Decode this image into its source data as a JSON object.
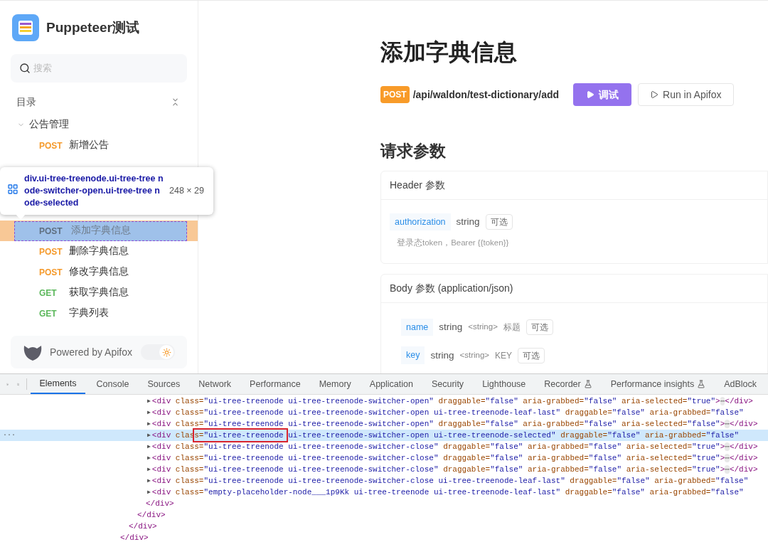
{
  "sidebar": {
    "project_title": "Puppeteer测试",
    "search": {
      "placeholder": "搜索"
    },
    "section_label": "目录",
    "tree": [
      {
        "label": "公告管理",
        "expanded": true,
        "children": [
          {
            "method": "POST",
            "color": "#f59a2b",
            "label": "新增公告",
            "selected": false
          },
          {
            "method": "POST",
            "label": "添加字典信息",
            "selected": true,
            "inspector_tooltip": {
              "selector": "div.ui-tree-treenode.ui-tree-tree node-switcher-open.ui-tree-tree node-selected",
              "size": "248 × 29"
            }
          },
          {
            "method": "POST",
            "color": "#f59a2b",
            "label": "删除字典信息",
            "selected": false
          },
          {
            "method": "POST",
            "color": "#f59a2b",
            "label": "修改字典信息",
            "selected": false
          },
          {
            "method": "GET",
            "color": "#5cb85c",
            "label": "获取字典信息",
            "selected": false
          },
          {
            "method": "GET",
            "color": "#5cb85c",
            "label": "字典列表",
            "selected": false
          }
        ]
      }
    ],
    "footer": {
      "text": "Powered by Apifox",
      "theme_toggle_on": true
    }
  },
  "main": {
    "title": "添加字典信息",
    "method": "POST",
    "path": "/api/waldon/test-dictionary/add",
    "debug_button": "调试",
    "run_button": "Run in Apifox",
    "params_title": "请求参数",
    "header_section": {
      "title": "Header 参数",
      "params": [
        {
          "name": "authorization",
          "type": "string",
          "optional": "可选",
          "description": "登录态token，Bearer {{token}}"
        }
      ]
    },
    "body_section": {
      "title": "Body 参数 (application/json)",
      "params": [
        {
          "name": "name",
          "type": "string",
          "subtype": "<string>",
          "description": "标题",
          "optional": "可选"
        },
        {
          "name": "key",
          "type": "string",
          "subtype": "<string>",
          "description": "KEY",
          "optional": "可选"
        }
      ]
    }
  },
  "devtools": {
    "tabs": [
      {
        "label": "Elements",
        "selected": true,
        "experimental": false
      },
      {
        "label": "Console",
        "selected": false,
        "experimental": false
      },
      {
        "label": "Sources",
        "selected": false,
        "experimental": false
      },
      {
        "label": "Network",
        "selected": false,
        "experimental": false
      },
      {
        "label": "Performance",
        "selected": false,
        "experimental": false
      },
      {
        "label": "Memory",
        "selected": false,
        "experimental": false
      },
      {
        "label": "Application",
        "selected": false,
        "experimental": false
      },
      {
        "label": "Security",
        "selected": false,
        "experimental": false
      },
      {
        "label": "Lighthouse",
        "selected": false,
        "experimental": false
      },
      {
        "label": "Recorder",
        "selected": false,
        "experimental": true
      },
      {
        "label": "Performance insights",
        "selected": false,
        "experimental": true
      },
      {
        "label": "AdBlock",
        "selected": false,
        "experimental": false
      }
    ],
    "nodes": [
      {
        "toggle": "▶",
        "code": "<div class=\"ui-tree-treenode ui-tree-treenode-switcher-open\" draggable=\"false\" aria-grabbed=\"false\" aria-selected=\"true\">⋯</div>",
        "selected": false,
        "boxed": false
      },
      {
        "toggle": "▶",
        "code": "<div class=\"ui-tree-treenode ui-tree-treenode-switcher-open ui-tree-treenode-leaf-last\" draggable=\"false\" aria-grabbed=\"false\"",
        "selected": false,
        "boxed": false
      },
      {
        "toggle": "▶",
        "code": "<div class=\"ui-tree-treenode ui-tree-treenode-switcher-open\" draggable=\"false\" aria-grabbed=\"false\" aria-selected=\"false\">⋯</div>",
        "selected": false,
        "boxed": false
      },
      {
        "toggle": "▶",
        "gutter": "···",
        "code": "<div class=\"ui-tree-treenode ui-tree-treenode-switcher-open ui-tree-treenode-selected\" draggable=\"false\" aria-grabbed=\"false\"",
        "selected": true,
        "boxed": true
      },
      {
        "toggle": "▶",
        "code": "<div class=\"ui-tree-treenode ui-tree-treenode-switcher-close\" draggable=\"false\" aria-grabbed=\"false\" aria-selected=\"true\">⋯</div>",
        "selected": false,
        "boxed": false
      },
      {
        "toggle": "▶",
        "code": "<div class=\"ui-tree-treenode ui-tree-treenode-switcher-close\" draggable=\"false\" aria-grabbed=\"false\" aria-selected=\"true\">⋯</div>",
        "selected": false,
        "boxed": false
      },
      {
        "toggle": "▶",
        "code": "<div class=\"ui-tree-treenode ui-tree-treenode-switcher-close\" draggable=\"false\" aria-grabbed=\"false\" aria-selected=\"true\">⋯</div>",
        "selected": false,
        "boxed": false
      },
      {
        "toggle": "▶",
        "code": "<div class=\"ui-tree-treenode ui-tree-treenode-switcher-close ui-tree-treenode-leaf-last\" draggable=\"false\" aria-grabbed=\"false\"",
        "selected": false,
        "boxed": false
      },
      {
        "toggle": "▶",
        "code": "<div class=\"empty-placeholder-node___1p9Kk ui-tree-treenode ui-tree-treenode-leaf-last\" draggable=\"false\" aria-grabbed=\"false\"",
        "selected": false,
        "boxed": false
      }
    ],
    "closing_tags": [
      "</div>",
      "</div>",
      "</div>",
      "</div>"
    ]
  }
}
